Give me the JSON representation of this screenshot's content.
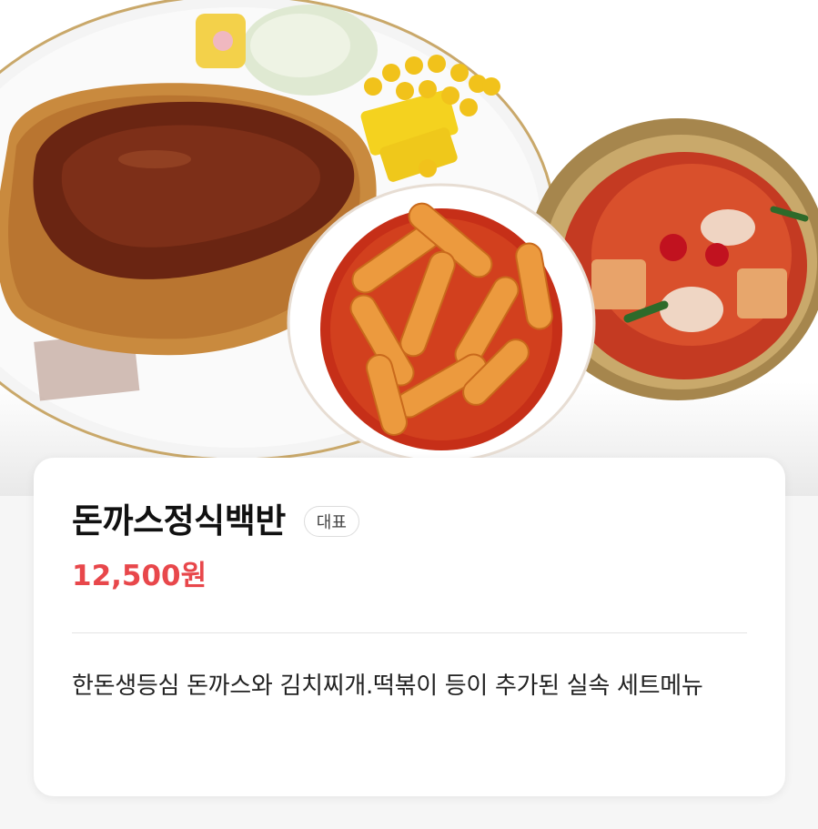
{
  "hero": {
    "image_name": "menu-photo"
  },
  "menu_item": {
    "name": "돈까스정식백반",
    "badge": "대표",
    "price": "12,500원",
    "description": "한돈생등심 돈까스와 김치찌개.떡볶이 등이 추가된 실속 세트메뉴"
  },
  "colors": {
    "price": "#e8474b",
    "badge_border": "#dcdcdc",
    "background": "#f6f6f6"
  }
}
